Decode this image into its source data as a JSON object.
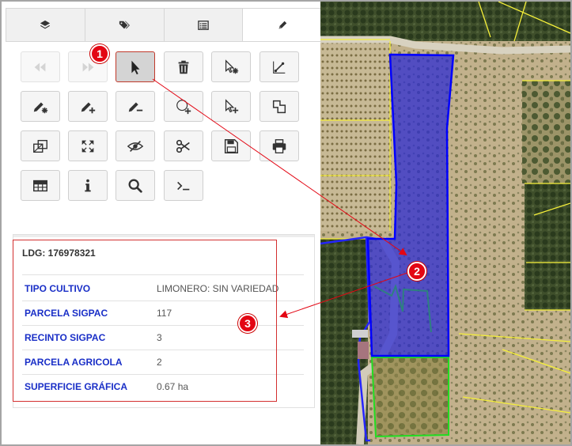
{
  "tabs": [
    {
      "icon": "layers-icon"
    },
    {
      "icon": "tags-icon"
    },
    {
      "icon": "list-icon"
    },
    {
      "icon": "pencil-icon",
      "active": true
    }
  ],
  "toolbar": [
    {
      "icon": "fast-backward-icon",
      "state": "disabled"
    },
    {
      "icon": "fast-forward-icon",
      "state": "disabled"
    },
    {
      "icon": "select-pointer-icon",
      "state": "selected"
    },
    {
      "icon": "trash-icon"
    },
    {
      "icon": "select-cursor-star-icon"
    },
    {
      "icon": "draw-line-icon"
    },
    {
      "icon": "edit-pencil-star-icon"
    },
    {
      "icon": "edit-pencil-plus-icon"
    },
    {
      "icon": "edit-pencil-minus-icon"
    },
    {
      "icon": "add-circle-icon"
    },
    {
      "icon": "select-cursor-plus-icon"
    },
    {
      "icon": "polygon-shape-icon"
    },
    {
      "icon": "split-shape-icon"
    },
    {
      "icon": "expand-arrows-icon"
    },
    {
      "icon": "hide-eye-icon"
    },
    {
      "icon": "scissors-icon"
    },
    {
      "icon": "save-icon"
    },
    {
      "icon": "print-icon"
    },
    {
      "icon": "table-icon"
    },
    {
      "icon": "info-icon"
    },
    {
      "icon": "search-icon"
    },
    {
      "icon": "terminal-icon"
    }
  ],
  "info": {
    "header": "LDG: 176978321",
    "rows": [
      {
        "label": "TIPO CULTIVO",
        "value": "LIMONERO: SIN VARIEDAD"
      },
      {
        "label": "PARCELA SIGPAC",
        "value": "117"
      },
      {
        "label": "RECINTO SIGPAC",
        "value": "3"
      },
      {
        "label": "PARCELA AGRICOLA",
        "value": "2"
      },
      {
        "label": "SUPERFICIE GRÁFICA",
        "value": "0.67 ha"
      }
    ]
  },
  "callouts": [
    "1",
    "2",
    "3"
  ],
  "colors": {
    "callout": "#e30613",
    "label": "#1a2fc7",
    "selected_parcel": "#2727d6",
    "parcel_border": "#ffff00",
    "neighbor_border": "#00ff00"
  }
}
